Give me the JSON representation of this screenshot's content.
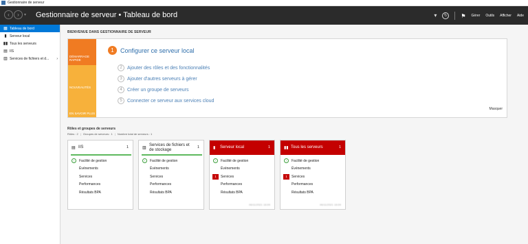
{
  "window": {
    "title": "Gestionnaire de serveur"
  },
  "header": {
    "app": "Gestionnaire de serveur",
    "separator": "•",
    "page": "Tableau de bord",
    "menus": [
      "Gérer",
      "Outils",
      "Afficher",
      "Aide"
    ]
  },
  "sidebar": {
    "items": [
      {
        "label": "Tableau de bord",
        "icon": "dashboard-icon",
        "active": true
      },
      {
        "label": "Serveur local",
        "icon": "server-icon"
      },
      {
        "label": "Tous les serveurs",
        "icon": "servers-icon"
      },
      {
        "label": "IIS",
        "icon": "iis-icon"
      },
      {
        "label": "Services de fichiers et d...",
        "icon": "files-icon",
        "chevron": "›"
      }
    ]
  },
  "welcome": {
    "title": "BIENVENUE DANS GESTIONNAIRE DE SERVEUR",
    "bands": [
      "DÉMARRAGE RAPIDE",
      "NOUVEAUTÉS",
      "EN SAVOIR PLUS"
    ],
    "main_step": {
      "num": "1",
      "label": "Configurer ce serveur local"
    },
    "steps": [
      {
        "num": "2",
        "label": "Ajouter des rôles et des fonctionnalités"
      },
      {
        "num": "3",
        "label": "Ajouter d'autres serveurs à gérer"
      },
      {
        "num": "4",
        "label": "Créer un groupe de serveurs"
      },
      {
        "num": "5",
        "label": "Connecter ce serveur aux services cloud"
      }
    ],
    "hide": "Masquer"
  },
  "roles": {
    "title": "Rôles et groupes de serveurs",
    "sub": [
      "Rôles : 2",
      "Groupes de serveurs : 1",
      "Nombre total de serveurs : 1"
    ],
    "tiles": [
      {
        "name": "IIS",
        "count": "1",
        "status": "ok",
        "rows": [
          "Facilité de gestion",
          "Événements",
          "Services",
          "Performances",
          "Résultats BPA"
        ],
        "services_alert": "",
        "timestamp": ""
      },
      {
        "name": "Services de fichiers et de stockage",
        "count": "1",
        "status": "ok",
        "rows": [
          "Facilité de gestion",
          "Événements",
          "Services",
          "Performances",
          "Résultats BPA"
        ],
        "services_alert": "",
        "timestamp": ""
      },
      {
        "name": "Serveur local",
        "count": "1",
        "status": "alert",
        "rows": [
          "Facilité de gestion",
          "Événements",
          "Services",
          "Performances",
          "Résultats BPA"
        ],
        "services_alert": "1",
        "timestamp": "06/11/2021 16:09"
      },
      {
        "name": "Tous les serveurs",
        "count": "1",
        "status": "alert",
        "rows": [
          "Facilité de gestion",
          "Événements",
          "Services",
          "Performances",
          "Résultats BPA"
        ],
        "services_alert": "1",
        "timestamp": "06/11/2021 16:09"
      }
    ]
  },
  "colors": {
    "header_bg": "#2b2b2b",
    "accent_blue": "#0078d7",
    "quickstart_orange": "#f07b22",
    "band_yellow": "#f7b13b",
    "alert_red": "#c40000",
    "ok_green": "#5cb85c"
  }
}
